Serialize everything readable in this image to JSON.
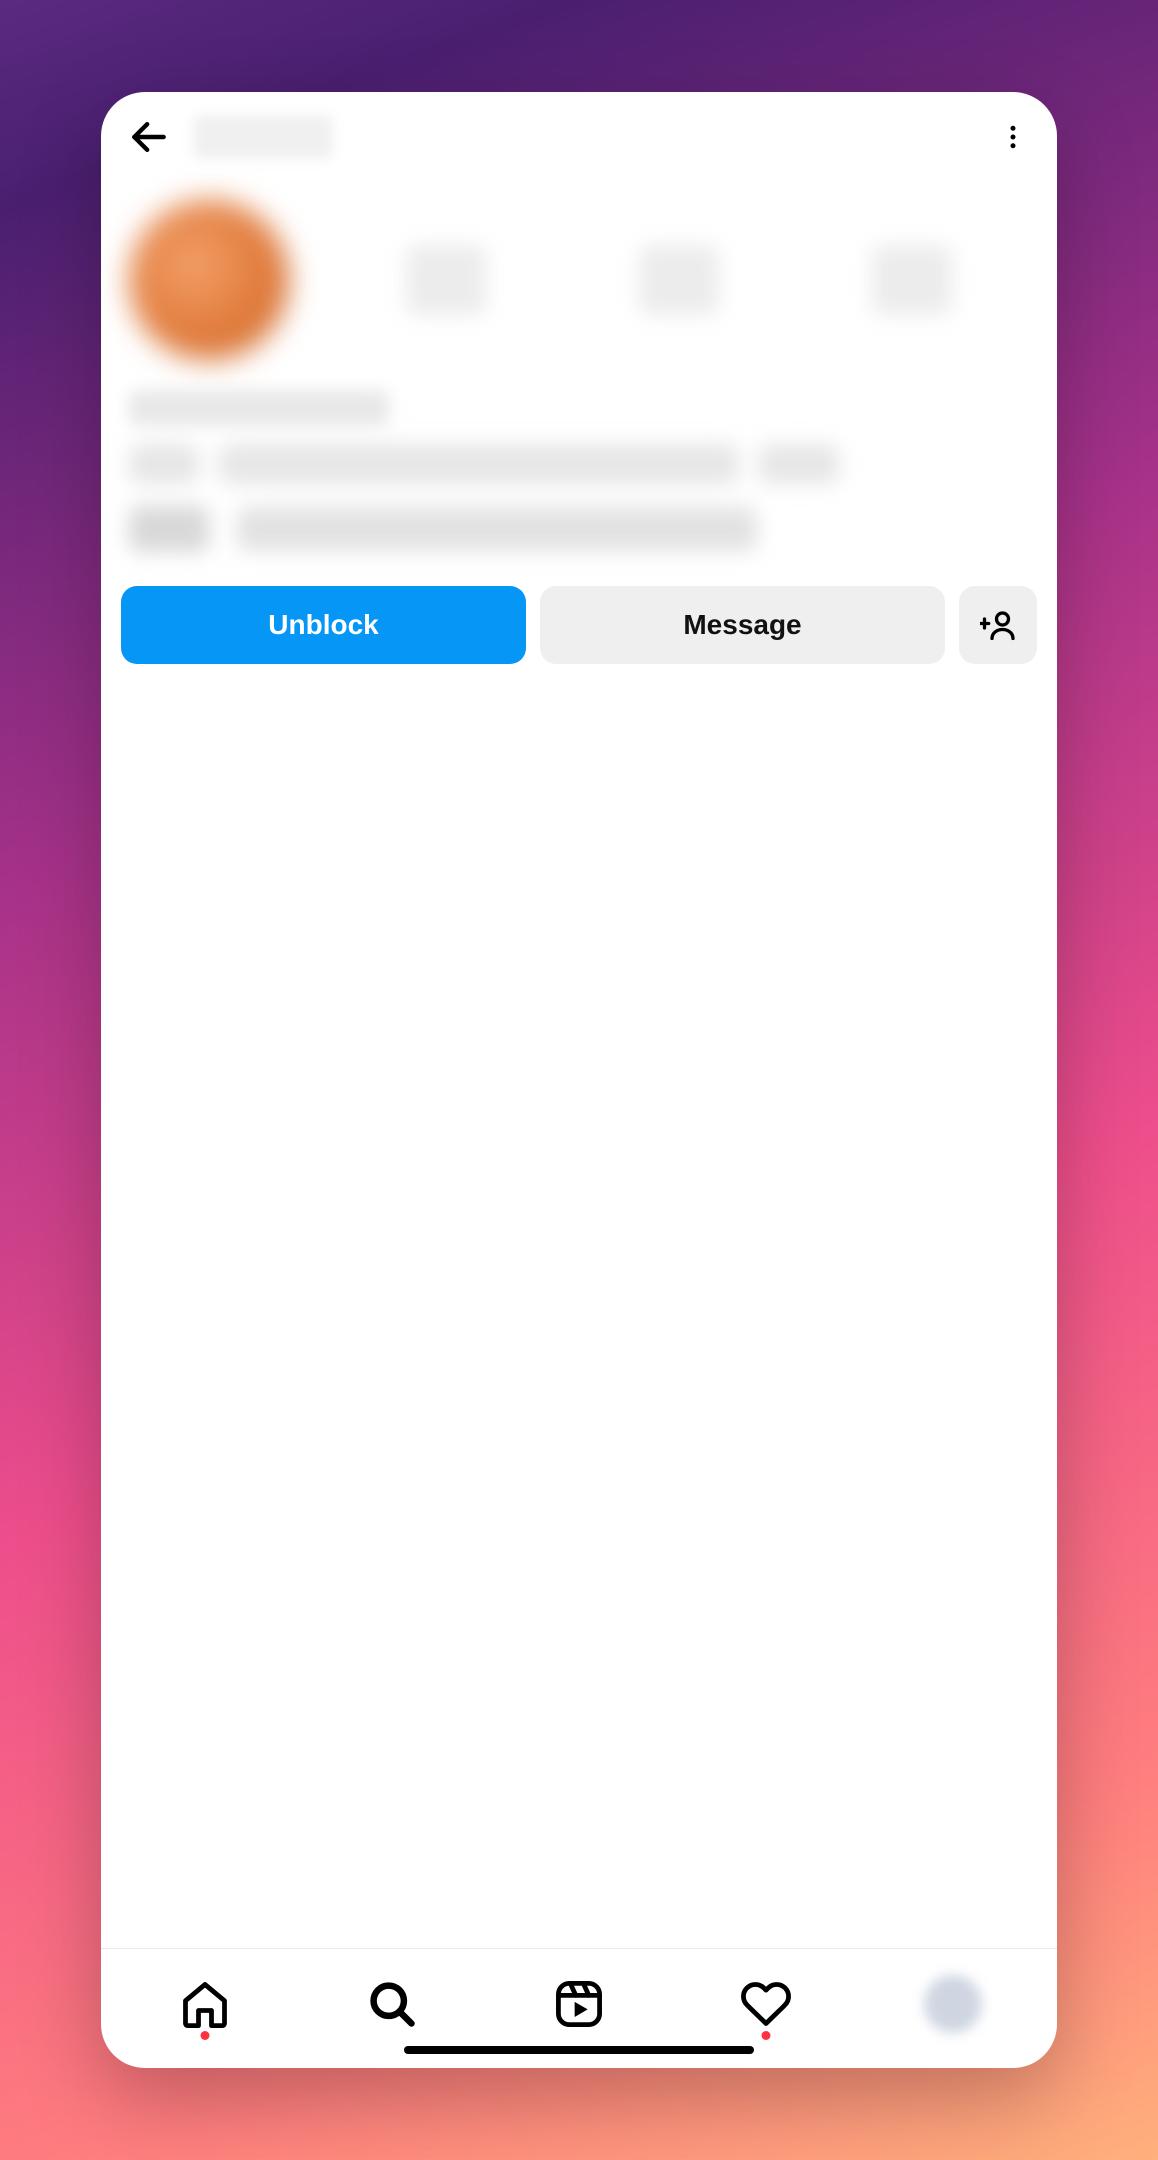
{
  "header": {
    "back_aria": "Back",
    "menu_aria": "More options"
  },
  "actions": {
    "unblock_label": "Unblock",
    "message_label": "Message",
    "suggest_aria": "Suggested accounts"
  },
  "bottom_nav": {
    "home_aria": "Home",
    "search_aria": "Search",
    "reels_aria": "Reels",
    "activity_aria": "Activity",
    "profile_aria": "Profile",
    "home_has_dot": true,
    "activity_has_dot": true
  },
  "colors": {
    "primary_button": "#0696f6",
    "secondary_button": "#efefef",
    "notification_dot": "#ff3040"
  }
}
